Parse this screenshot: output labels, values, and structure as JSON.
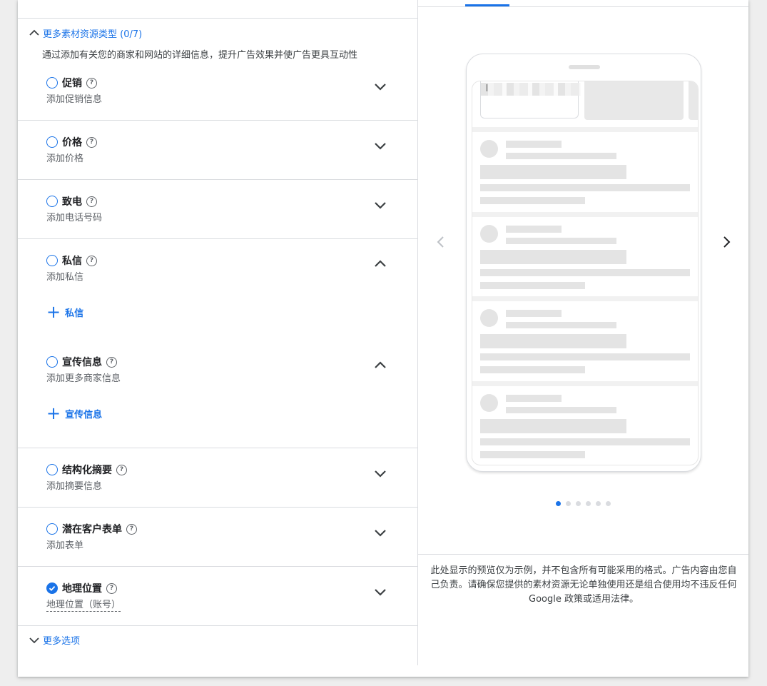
{
  "left": {
    "more_types_label": "更多素材资源类型 (0/7)",
    "more_types_desc": "通过添加有关您的商家和网站的详细信息，提升广告效果并使广告更具互动性",
    "rows": [
      {
        "title": "促销",
        "subtitle": "添加促销信息",
        "state": "collapsed"
      },
      {
        "title": "价格",
        "subtitle": "添加价格",
        "state": "collapsed"
      },
      {
        "title": "致电",
        "subtitle": "添加电话号码",
        "state": "collapsed"
      },
      {
        "title": "私信",
        "subtitle": "添加私信",
        "state": "expanded",
        "add_label": "私信"
      },
      {
        "title": "宣传信息",
        "subtitle": "添加更多商家信息",
        "state": "expanded",
        "add_label": "宣传信息"
      },
      {
        "title": "结构化摘要",
        "subtitle": "添加摘要信息",
        "state": "collapsed"
      },
      {
        "title": "潜在客户表单",
        "subtitle": "添加表单",
        "state": "collapsed"
      },
      {
        "title": "地理位置",
        "subtitle": "地理位置（账号）",
        "state": "collapsed",
        "checked": true
      }
    ],
    "more_options_label": "更多选项"
  },
  "preview": {
    "carousel_pages": 6,
    "active_page": 1,
    "disclaimer": "此处显示的预览仅为示例，并不包含所有可能采用的格式。广告内容由您自己负责。请确保您提供的素材资源无论单独使用还是组合使用均不违反任何 Google 政策或适用法律。"
  },
  "colors": {
    "accent": "#1a73e8",
    "divider": "#dadce0",
    "skeleton": "#e4e4e4"
  }
}
